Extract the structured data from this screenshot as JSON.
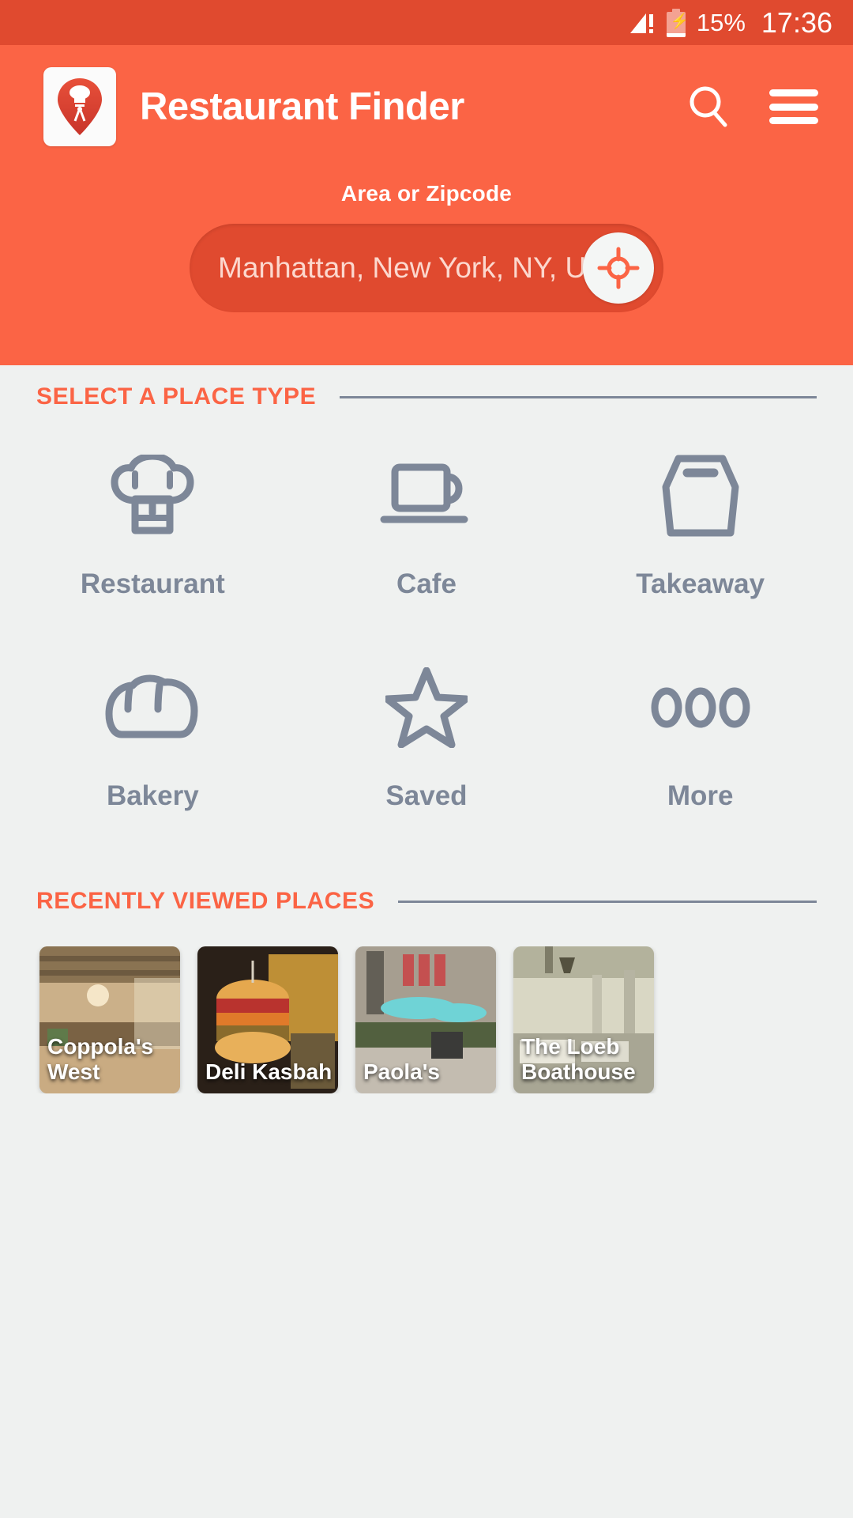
{
  "statusbar": {
    "signal_icon": "signal-warning-icon",
    "battery_icon": "battery-charging-icon",
    "battery_percent": "15%",
    "time": "17:36"
  },
  "header": {
    "logo_icon": "restaurant-pin-logo",
    "title": "Restaurant Finder",
    "search_icon": "search-icon",
    "menu_icon": "hamburger-menu-icon"
  },
  "search": {
    "label": "Area or Zipcode",
    "value": "Manhattan, New York, NY, U",
    "placeholder": "Area or Zipcode",
    "gps_icon": "crosshair-location-icon"
  },
  "place_types": {
    "section_title": "SELECT A PLACE TYPE",
    "items": [
      {
        "label": "Restaurant",
        "icon": "chef-hat-icon"
      },
      {
        "label": "Cafe",
        "icon": "coffee-cup-icon"
      },
      {
        "label": "Takeaway",
        "icon": "takeaway-bag-icon"
      },
      {
        "label": "Bakery",
        "icon": "bread-loaf-icon"
      },
      {
        "label": "Saved",
        "icon": "star-outline-icon"
      },
      {
        "label": "More",
        "icon": "three-dots-icon"
      }
    ]
  },
  "recent": {
    "section_title": "RECENTLY VIEWED PLACES",
    "places": [
      {
        "name": "Coppola's West"
      },
      {
        "name": "Deli Kasbah"
      },
      {
        "name": "Paola's"
      },
      {
        "name": "The Loeb Boathouse"
      }
    ]
  },
  "colors": {
    "status_bar": "#e04a2f",
    "header": "#fb6445",
    "accent": "#fb6445",
    "sheet_bg": "#eff1f0",
    "icon_gray": "#7d8798",
    "search_field": "#e04a2f"
  }
}
